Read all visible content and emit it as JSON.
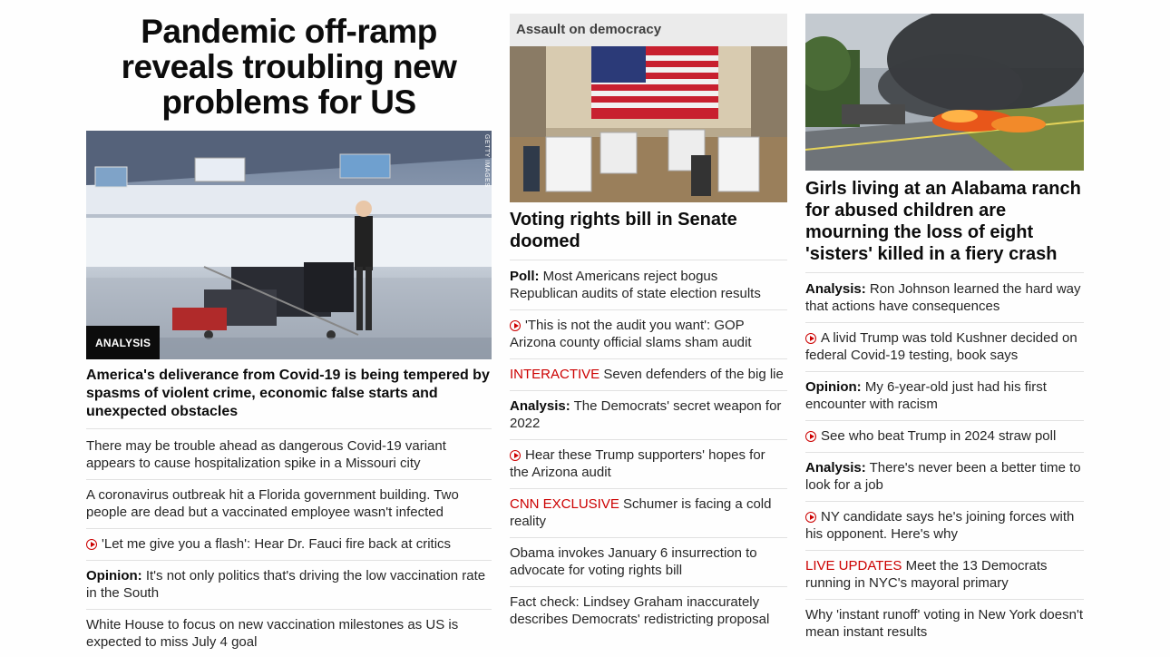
{
  "col1": {
    "headline": "Pandemic off-ramp reveals troubling new problems for US",
    "image": {
      "badge": "ANALYSIS",
      "credit": "GETTY IMAGES"
    },
    "subheadline": "America's deliverance from Covid-19 is being tempered by spasms of violent crime, economic false starts and unexpected obstacles",
    "items": [
      {
        "kicker": "",
        "text": "There may be trouble ahead as dangerous Covid-19 variant appears to cause hospitalization spike in a Missouri city",
        "video": false
      },
      {
        "kicker": "",
        "text": "A coronavirus outbreak hit a Florida government building. Two people are dead but a vaccinated employee wasn't infected",
        "video": false
      },
      {
        "kicker": "",
        "text": "'Let me give you a flash': Hear Dr. Fauci fire back at critics",
        "video": true
      },
      {
        "kicker": "Opinion:",
        "text": "It's not only politics that's driving the low vaccination rate in the South",
        "video": false
      },
      {
        "kicker": "",
        "text": "White House to focus on new vaccination milestones as US is expected to miss July 4 goal",
        "video": false
      }
    ]
  },
  "col2": {
    "section_label": "Assault on democracy",
    "title": "Voting rights bill in Senate doomed",
    "items": [
      {
        "kicker": "Poll:",
        "red_kicker": "",
        "text": "Most Americans reject bogus Republican audits of state election results",
        "video": false
      },
      {
        "kicker": "",
        "red_kicker": "",
        "text": "'This is not the audit you want': GOP Arizona county official slams sham audit",
        "video": true
      },
      {
        "kicker": "",
        "red_kicker": "INTERACTIVE",
        "text": "Seven defenders of the big lie",
        "video": false
      },
      {
        "kicker": "Analysis:",
        "red_kicker": "",
        "text": "The Democrats' secret weapon for 2022",
        "video": false
      },
      {
        "kicker": "",
        "red_kicker": "",
        "text": "Hear these Trump supporters' hopes for the Arizona audit",
        "video": true
      },
      {
        "kicker": "",
        "red_kicker": "CNN EXCLUSIVE",
        "text": "Schumer is facing a cold reality",
        "video": false
      },
      {
        "kicker": "",
        "red_kicker": "",
        "text": "Obama invokes January 6 insurrection to advocate for voting rights bill",
        "video": false
      },
      {
        "kicker": "",
        "red_kicker": "",
        "text": "Fact check: Lindsey Graham inaccurately describes Democrats' redistricting proposal",
        "video": false
      }
    ]
  },
  "col3": {
    "title": "Girls living at an Alabama ranch for abused children are mourning the loss of eight 'sisters' killed in a fiery crash",
    "items": [
      {
        "kicker": "Analysis:",
        "red_kicker": "",
        "text": "Ron Johnson learned the hard way that actions have consequences",
        "video": false
      },
      {
        "kicker": "",
        "red_kicker": "",
        "text": "A livid Trump was told Kushner decided on federal Covid-19 testing, book says",
        "video": true
      },
      {
        "kicker": "Opinion:",
        "red_kicker": "",
        "text": "My 6-year-old just had his first encounter with racism",
        "video": false
      },
      {
        "kicker": "",
        "red_kicker": "",
        "text": "See who beat Trump in 2024 straw poll",
        "video": true
      },
      {
        "kicker": "Analysis:",
        "red_kicker": "",
        "text": "There's never been a better time to look for a job",
        "video": false
      },
      {
        "kicker": "",
        "red_kicker": "",
        "text": "NY candidate says he's joining forces with his opponent. Here's why",
        "video": true
      },
      {
        "kicker": "",
        "red_kicker": "LIVE UPDATES",
        "text": "Meet the 13 Democrats running in NYC's mayoral primary",
        "video": false
      },
      {
        "kicker": "",
        "red_kicker": "",
        "text": "Why 'instant runoff' voting in New York doesn't mean instant results",
        "video": false
      }
    ]
  },
  "colors": {
    "accent_red": "#cc0000",
    "text": "#262626",
    "divider": "#e1e1e1"
  },
  "icons": {
    "video": "play-circle-icon"
  }
}
